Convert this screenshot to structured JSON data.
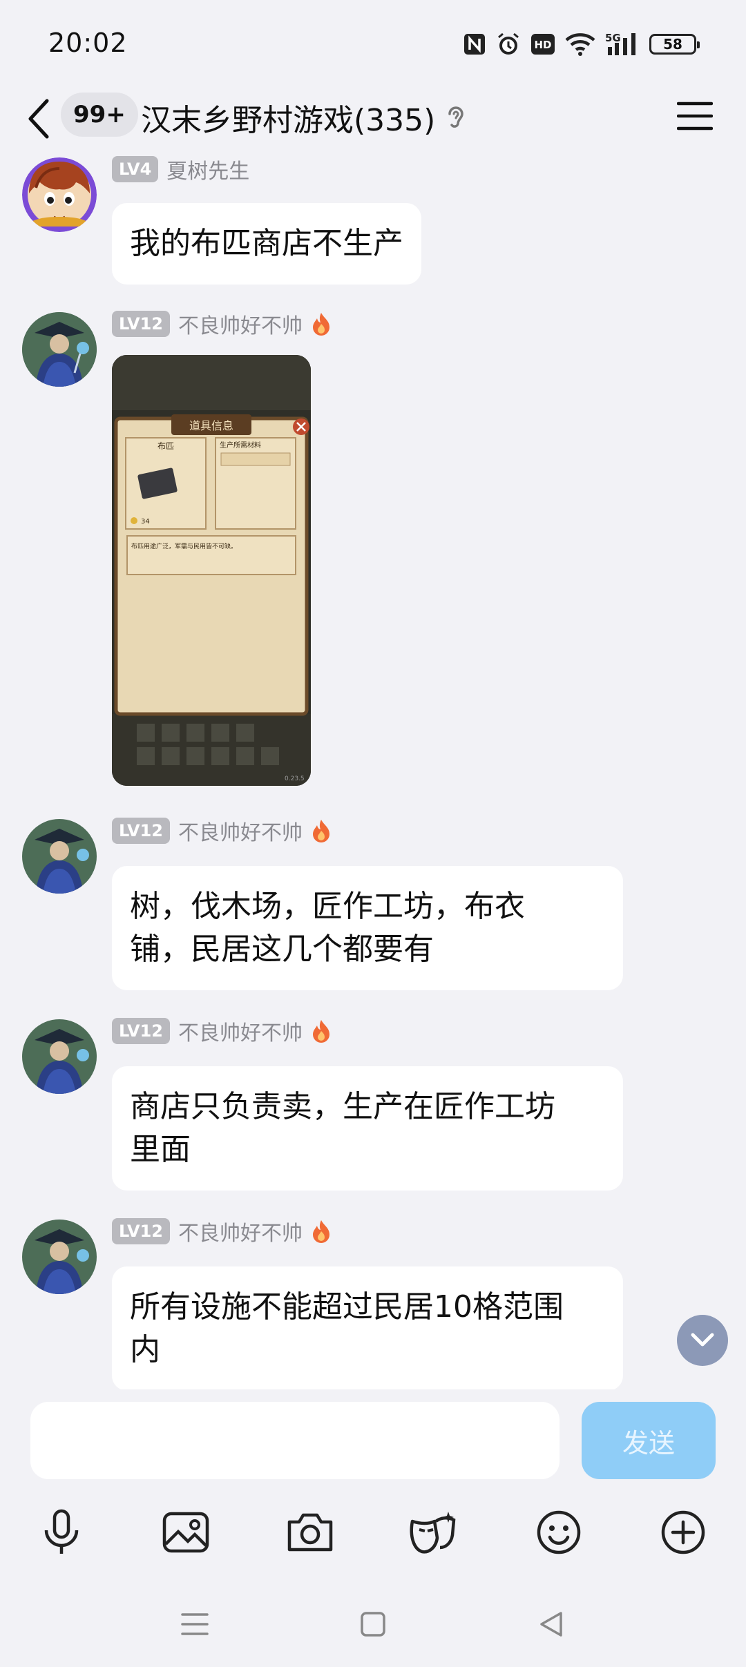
{
  "status_bar": {
    "time": "20:02",
    "icons": [
      "nfc-icon",
      "alarm-icon",
      "hd-icon",
      "wifi-icon",
      "5g-signal-icon"
    ],
    "battery": "58"
  },
  "header": {
    "unread_count": "99+",
    "group_title": "汉末乡野村游戏(335)"
  },
  "messages": [
    {
      "level": "LV4",
      "nickname": "夏树先生",
      "has_flame": false,
      "type": "text",
      "text": "我的布匹商店不生产"
    },
    {
      "level": "LV12",
      "nickname": "不良帅好不帅",
      "has_flame": true,
      "type": "image",
      "image": {
        "dialog_title": "道具信息",
        "item_name": "布匹",
        "produced_by_label": "生产所需材料",
        "description": "布匹用途广泛，军需与民用皆不可缺。",
        "count": "34",
        "version": "0.23.5"
      }
    },
    {
      "level": "LV12",
      "nickname": "不良帅好不帅",
      "has_flame": true,
      "type": "text",
      "text_lines": [
        "树，伐木场，匠作工坊，布衣",
        "铺，民居这几个都要有"
      ]
    },
    {
      "level": "LV12",
      "nickname": "不良帅好不帅",
      "has_flame": true,
      "type": "text",
      "text_lines": [
        "商店只负责卖，生产在匠作工坊",
        "里面"
      ]
    },
    {
      "level": "LV12",
      "nickname": "不良帅好不帅",
      "has_flame": true,
      "type": "text",
      "text_lines": [
        "所有设施不能超过民居10格范围",
        "内"
      ]
    }
  ],
  "input": {
    "value": "",
    "placeholder": "",
    "send_label": "发送"
  },
  "toolbar_icons": [
    "microphone-icon",
    "image-icon",
    "camera-icon",
    "mask-icon",
    "emoji-icon",
    "plus-icon"
  ],
  "nav_icons": [
    "menu-nav-icon",
    "home-nav-icon",
    "back-nav-icon"
  ],
  "colors": {
    "background": "#f2f2f6",
    "bubble": "#ffffff",
    "send_button": "#8fcdf7",
    "level_badge": "#b9b9be",
    "flame": "#f06a35"
  }
}
